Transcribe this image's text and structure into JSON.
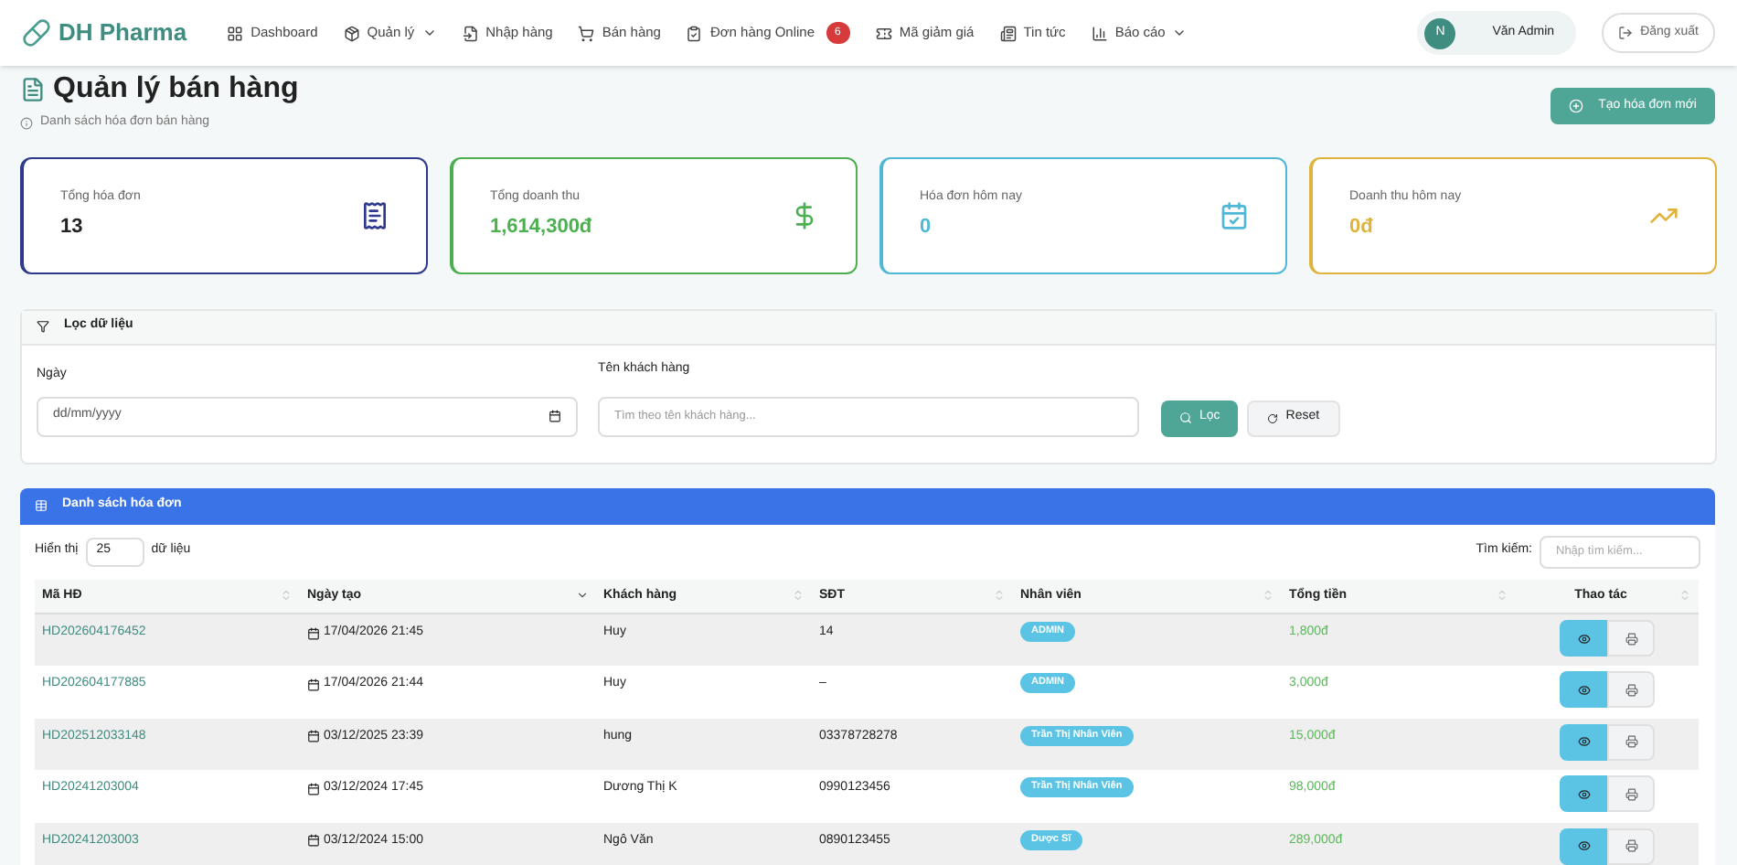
{
  "brand": "DH Pharma",
  "nav": [
    {
      "label": "Dashboard",
      "dropdown": false
    },
    {
      "label": "Quản lý",
      "dropdown": true
    },
    {
      "label": "Nhập hàng",
      "dropdown": false
    },
    {
      "label": "Bán hàng",
      "dropdown": false
    },
    {
      "label": "Đơn hàng Online",
      "dropdown": false,
      "badge": "6"
    },
    {
      "label": "Mã giảm giá",
      "dropdown": false
    },
    {
      "label": "Tin tức",
      "dropdown": false
    },
    {
      "label": "Báo cáo",
      "dropdown": true
    }
  ],
  "user": {
    "initial": "N",
    "name": "Văn Admin"
  },
  "logout": "Đăng xuất",
  "page": {
    "title": "Quản lý bán hàng",
    "subtitle": "Danh sách hóa đơn bán hàng",
    "create_button": "Tạo hóa đơn mới"
  },
  "stats": [
    {
      "label": "Tổng hóa đơn",
      "value": "13",
      "color": "#2f3a8f"
    },
    {
      "label": "Tổng doanh thu",
      "value": "1,614,300đ",
      "color": "#4caf50"
    },
    {
      "label": "Hóa đơn hôm nay",
      "value": "0",
      "color": "#4fb8d6"
    },
    {
      "label": "Doanh thu hôm nay",
      "value": "0đ",
      "color": "#e0b43c"
    }
  ],
  "filter": {
    "title": "Lọc dữ liệu",
    "date_label": "Ngày",
    "date_placeholder": "dd/mm/yyyy",
    "customer_label": "Tên khách hàng",
    "customer_placeholder": "Tìm theo tên khách hàng...",
    "filter_button": "Lọc",
    "reset_button": "Reset"
  },
  "table": {
    "title": "Danh sách hóa đơn",
    "show_label": "Hiển thị",
    "page_size": "25",
    "show_suffix": "dữ liệu",
    "search_label": "Tìm kiếm:",
    "search_placeholder": "Nhập tìm kiếm...",
    "columns": [
      {
        "label": "Mã HĐ",
        "sorted": false
      },
      {
        "label": "Ngày tạo",
        "sorted": true
      },
      {
        "label": "Khách hàng",
        "sorted": false
      },
      {
        "label": "SĐT",
        "sorted": false
      },
      {
        "label": "Nhân viên",
        "sorted": false
      },
      {
        "label": "Tổng tiền",
        "sorted": false
      },
      {
        "label": "Thao tác",
        "sorted": false
      }
    ],
    "rows": [
      {
        "id": "HD202604176452",
        "date": "17/04/2026 21:45",
        "customer": "Huy",
        "phone": "14",
        "staff": "ADMIN",
        "total": "1,800đ"
      },
      {
        "id": "HD202604177885",
        "date": "17/04/2026 21:44",
        "customer": "Huy",
        "phone": "–",
        "staff": "ADMIN",
        "total": "3,000đ"
      },
      {
        "id": "HD202512033148",
        "date": "03/12/2025 23:39",
        "customer": "hung",
        "phone": "03378728278",
        "staff": "Trần Thị Nhân Viên",
        "total": "15,000đ"
      },
      {
        "id": "HD20241203004",
        "date": "03/12/2024 17:45",
        "customer": "Dương Thị K",
        "phone": "0990123456",
        "staff": "Trần Thị Nhân Viên",
        "total": "98,000đ"
      },
      {
        "id": "HD20241203003",
        "date": "03/12/2024 15:00",
        "customer": "Ngô Văn",
        "phone": "0890123455",
        "staff": "Dược Sĩ",
        "total": "289,000đ"
      }
    ]
  }
}
